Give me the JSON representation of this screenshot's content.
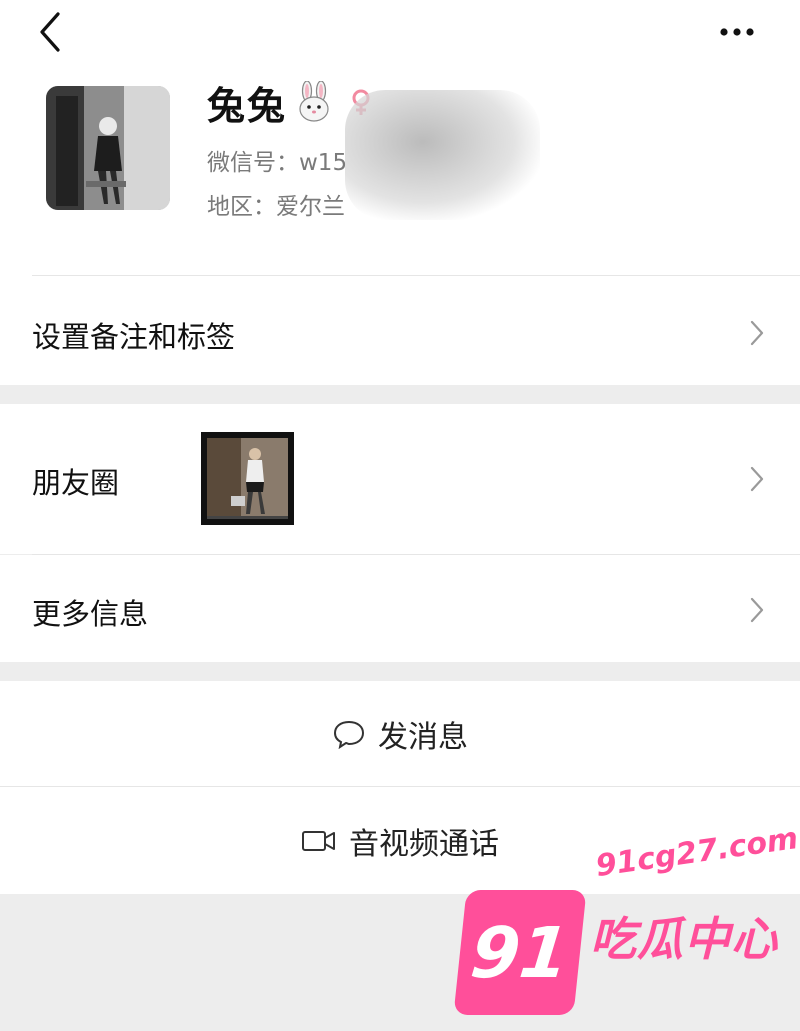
{
  "profile": {
    "name": "兔兔",
    "wechat_id": "微信号：w15",
    "region": "地区：爱尔兰",
    "emoji_icon": "rabbit-icon",
    "gender_icon": "female-icon"
  },
  "menu": {
    "remark_label": "设置备注和标签",
    "moments_label": "朋友圈",
    "more_info_label": "更多信息"
  },
  "actions": {
    "message_label": "发消息",
    "call_label": "音视频通话"
  },
  "watermark": {
    "url": "91cg27.com",
    "badge": "91",
    "text": "吃瓜中心"
  },
  "colors": {
    "background": "#ededed",
    "card": "#ffffff",
    "watermark_pink": "#ff4f9a"
  }
}
